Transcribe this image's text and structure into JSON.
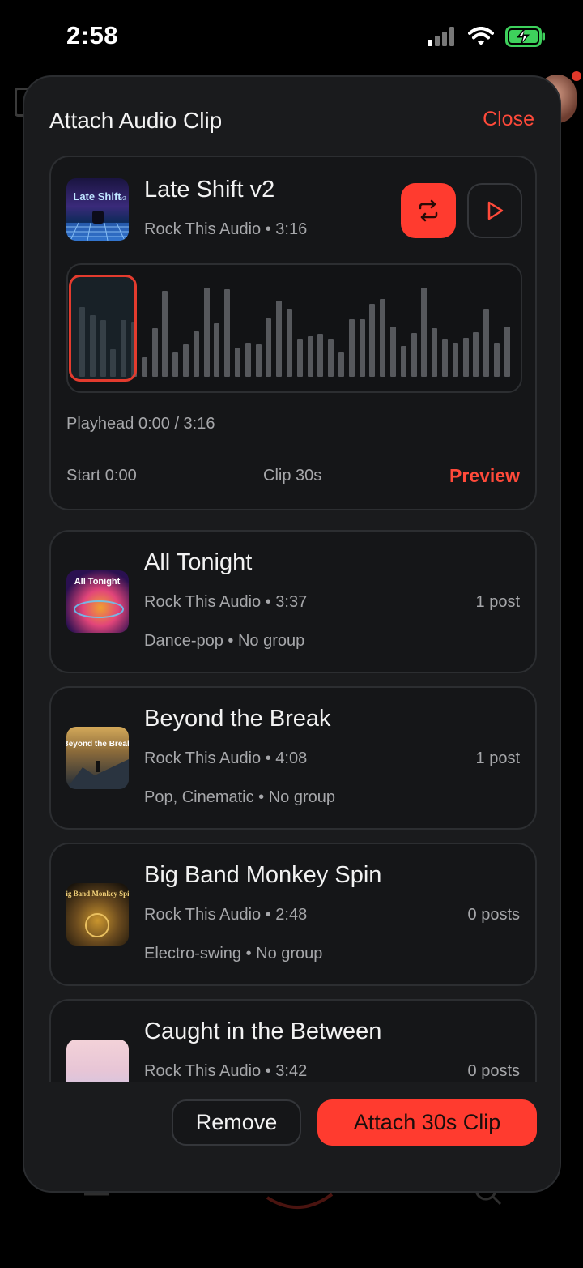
{
  "status_bar": {
    "time": "2:58"
  },
  "sheet": {
    "title": "Attach Audio Clip",
    "close_label": "Close"
  },
  "selected_track": {
    "title": "Late Shift v2",
    "meta": "Rock This Audio • 3:16",
    "cover_text": "Late Shift",
    "cover_text_small": "v2",
    "playhead": "Playhead 0:00 / 3:16",
    "start": "Start 0:00",
    "clip": "Clip 30s",
    "preview_label": "Preview",
    "waveform_levels": [
      0.72,
      0.63,
      0.58,
      0.28,
      0.58,
      0.56,
      0.2,
      0.5,
      0.88,
      0.25,
      0.33,
      0.47,
      0.92,
      0.55,
      0.9,
      0.3,
      0.35,
      0.33,
      0.6,
      0.78,
      0.7,
      0.38,
      0.42,
      0.44,
      0.38,
      0.25,
      0.59,
      0.59,
      0.75,
      0.8,
      0.52,
      0.32,
      0.45,
      0.92,
      0.5,
      0.38,
      0.35,
      0.4,
      0.46,
      0.7,
      0.35,
      0.52
    ]
  },
  "tracks": [
    {
      "title": "All Tonight",
      "meta": "Rock This Audio • 3:37",
      "posts": "1 post",
      "tags": "Dance-pop • No group",
      "cover_text": "All Tonight",
      "cover_colors": [
        "#2a1050",
        "#e2457a",
        "#f0a030"
      ]
    },
    {
      "title": "Beyond the Break",
      "meta": "Rock This Audio • 4:08",
      "posts": "1 post",
      "tags": "Pop, Cinematic • No group",
      "cover_text": "Beyond the Break",
      "cover_colors": [
        "#1e2a38",
        "#8a6a3a",
        "#d4a95a"
      ]
    },
    {
      "title": "Big Band Monkey Spin",
      "meta": "Rock This Audio • 2:48",
      "posts": "0 posts",
      "tags": "Electro-swing • No group",
      "cover_text": "Big Band Monkey Spin",
      "cover_colors": [
        "#1a140c",
        "#6a4a1e",
        "#c9952e"
      ]
    },
    {
      "title": "Caught in the Between",
      "meta": "Rock This Audio • 3:42",
      "posts": "0 posts",
      "tags": "",
      "cover_text": "",
      "cover_colors": [
        "#f3d2d8",
        "#e7c5d6",
        "#c9c4e6"
      ]
    }
  ],
  "footer": {
    "remove_label": "Remove",
    "attach_label": "Attach 30s Clip"
  },
  "colors": {
    "accent": "#ff3b2f",
    "sheet_bg": "#1a1b1d",
    "card_bg": "#151618"
  },
  "icons": [
    "cellular-signal-icon",
    "wifi-icon",
    "battery-charging-icon",
    "loop-icon",
    "play-icon"
  ]
}
